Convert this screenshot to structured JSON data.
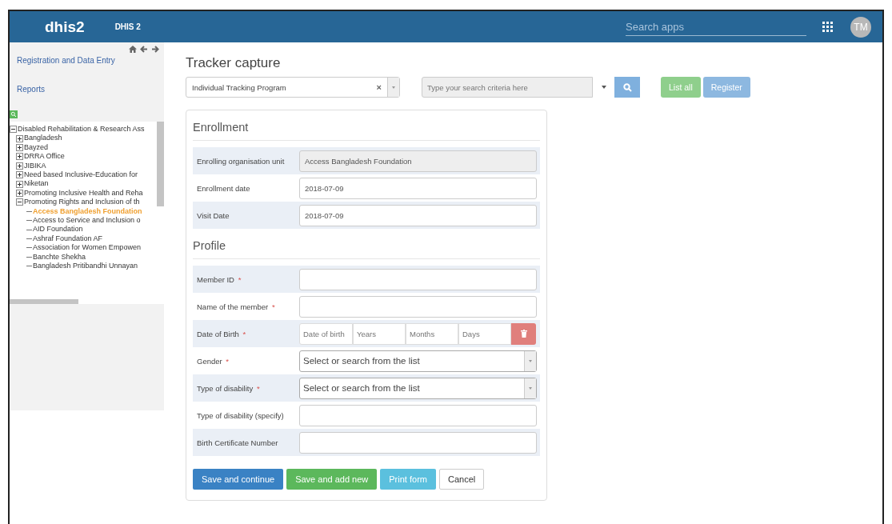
{
  "header": {
    "logo": "dhis2",
    "app_name": "DHIS 2",
    "search": {
      "placeholder": "Search apps"
    },
    "avatar": "TM"
  },
  "sidebar": {
    "links": [
      {
        "label": "Registration and Data Entry"
      },
      {
        "label": "Reports"
      }
    ],
    "tree": [
      {
        "label": "Disabled Rehabilitation & Research Ass",
        "expanded": true,
        "selected": false,
        "children": [
          {
            "label": "Bangladesh",
            "expanded": false,
            "selected": false
          },
          {
            "label": "Bayzed",
            "expanded": false,
            "selected": false
          },
          {
            "label": "DRRA Office",
            "expanded": false,
            "selected": false
          },
          {
            "label": "JIBIKA",
            "expanded": false,
            "selected": false
          },
          {
            "label": "Need based Inclusive-Education for",
            "expanded": false,
            "selected": false
          },
          {
            "label": "Niketan",
            "expanded": false,
            "selected": false
          },
          {
            "label": "Promoting Inclusive Health and Reha",
            "expanded": false,
            "selected": false
          },
          {
            "label": "Promoting Rights and Inclusion of th",
            "expanded": true,
            "selected": false,
            "children": [
              {
                "label": "Access Bangladesh Foundation",
                "selected": true
              },
              {
                "label": "Access to Service and Inclusion o",
                "selected": false
              },
              {
                "label": "AID Foundation",
                "selected": false
              },
              {
                "label": "Ashraf Foundation AF",
                "selected": false
              },
              {
                "label": "Association for Women Empowen",
                "selected": false
              },
              {
                "label": "Banchte Shekha",
                "selected": false
              },
              {
                "label": "Bangladesh Pritibandhi Unnayan",
                "selected": false
              }
            ]
          }
        ]
      }
    ]
  },
  "main": {
    "title": "Tracker capture",
    "program": {
      "value": "Individual Tracking Program",
      "clear": "×"
    },
    "search": {
      "placeholder": "Type your search criteria here"
    },
    "buttons": [
      {
        "label": "List all",
        "kind": "success"
      },
      {
        "label": "Register",
        "kind": "primary"
      }
    ]
  },
  "form": {
    "required_mark": "*",
    "sections": [
      {
        "title": "Enrollment",
        "fields": [
          {
            "label": "Enrolling organisation unit",
            "kind": "readonly",
            "required": false,
            "value": "Access Bangladesh Foundation"
          },
          {
            "label": "Enrollment date",
            "kind": "text",
            "required": false,
            "value": "2018-07-09"
          },
          {
            "label": "Visit Date",
            "kind": "text",
            "required": false,
            "value": "2018-07-09"
          }
        ]
      },
      {
        "title": "Profile",
        "fields": [
          {
            "label": "Member ID",
            "kind": "text",
            "required": true
          },
          {
            "label": "Name of the member",
            "kind": "text",
            "required": true
          },
          {
            "label": "Date of Birth",
            "kind": "dob",
            "required": true,
            "placeholders": [
              "Date of birth",
              "Years",
              "Months",
              "Days"
            ]
          },
          {
            "label": "Gender",
            "kind": "select",
            "required": true,
            "placeholder": "Select or search from the list"
          },
          {
            "label": "Type of disability",
            "kind": "select",
            "required": true,
            "placeholder": "Select or search from the list"
          },
          {
            "label": "Type of disability (specify)",
            "kind": "text",
            "required": false
          },
          {
            "label": "Birth Certificate Number",
            "kind": "text",
            "required": false
          }
        ]
      }
    ],
    "actions": [
      {
        "label": "Save and continue",
        "kind": "primary"
      },
      {
        "label": "Save and add new",
        "kind": "success"
      },
      {
        "label": "Print form",
        "kind": "info"
      },
      {
        "label": "Cancel",
        "kind": "default"
      }
    ]
  }
}
